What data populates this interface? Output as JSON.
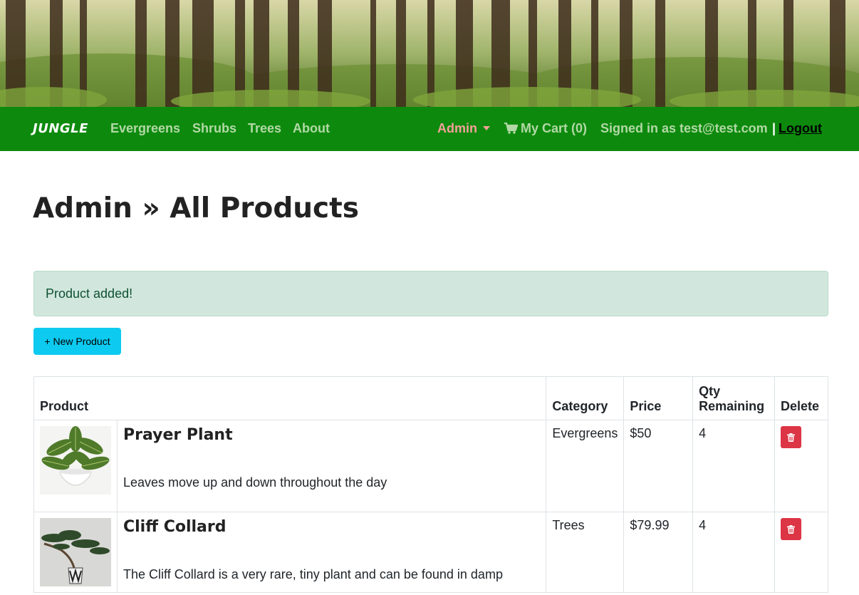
{
  "navbar": {
    "brand": "JUNGLE",
    "links": [
      "Evergreens",
      "Shrubs",
      "Trees",
      "About"
    ],
    "admin_label": "Admin",
    "cart_label": "My Cart (0)",
    "signed_in_text": "Signed in as test@test.com",
    "separator": "|",
    "logout_label": "Logout"
  },
  "page": {
    "title": "Admin » All Products"
  },
  "alert": {
    "message": "Product added!"
  },
  "actions": {
    "new_product_label": "+ New Product"
  },
  "table": {
    "headers": {
      "product": "Product",
      "category": "Category",
      "price": "Price",
      "qty_line1": "Qty",
      "qty_line2": "Remaining",
      "delete": "Delete"
    },
    "rows": [
      {
        "name": "Prayer Plant",
        "description": "Leaves move up and down throughout the day",
        "category": "Evergreens",
        "price": "$50",
        "qty": "4"
      },
      {
        "name": "Cliff Collard",
        "description": "The Cliff Collard is a very rare, tiny plant and can be found in damp",
        "category": "Trees",
        "price": "$79.99",
        "qty": "4"
      }
    ]
  },
  "icons": {
    "cart": "shopping-cart-icon",
    "trash": "trash-icon",
    "caret": "caret-down-icon"
  },
  "colors": {
    "navbar_bg": "#0d8a0d",
    "nav_link": "#b2d8a6",
    "admin_link": "#f4a19a",
    "alert_bg": "#d1e7dd",
    "alert_text": "#0f5132",
    "new_button_bg": "#0dcaf0",
    "delete_button_bg": "#dc3545"
  }
}
